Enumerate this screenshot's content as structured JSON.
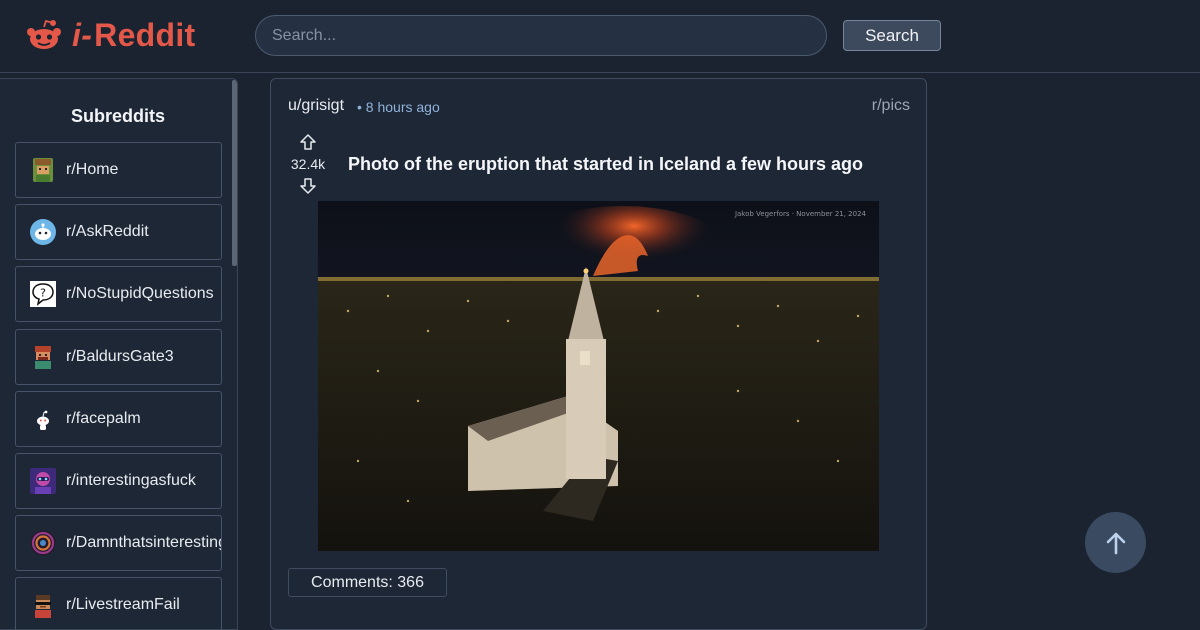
{
  "app": {
    "logo_prefix": "i-",
    "logo_name": "Reddit",
    "brand_color": "#e4584a"
  },
  "search": {
    "placeholder": "Search...",
    "button_label": "Search"
  },
  "sidebar": {
    "title": "Subreddits",
    "items": [
      {
        "label": "r/Home",
        "icon": "pixel-character-icon"
      },
      {
        "label": "r/AskReddit",
        "icon": "askreddit-snoo-icon"
      },
      {
        "label": "r/NoStupidQuestions",
        "icon": "question-bubble-icon"
      },
      {
        "label": "r/BaldursGate3",
        "icon": "pixel-character-icon"
      },
      {
        "label": "r/facepalm",
        "icon": "snoo-icon"
      },
      {
        "label": "r/interestingasfuck",
        "icon": "purple-avatar-icon"
      },
      {
        "label": "r/Damnthatsinteresting",
        "icon": "swirl-icon"
      },
      {
        "label": "r/LivestreamFail",
        "icon": "sunglasses-avatar-icon"
      }
    ]
  },
  "post": {
    "user": "u/grisigt",
    "time": "• 8 hours ago",
    "subreddit": "r/pics",
    "score": "32.4k",
    "title": "Photo of the eruption that started in Iceland a few hours ago",
    "image_credit": "Jakob Vegerfors · November 21, 2024",
    "comments_label": "Comments: 366"
  }
}
